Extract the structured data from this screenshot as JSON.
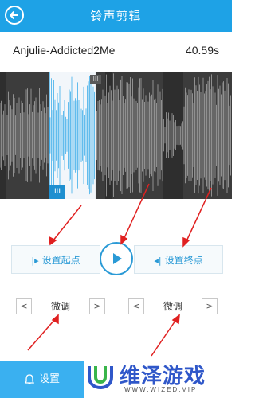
{
  "header": {
    "title": "铃声剪辑",
    "back_icon": "back-arrow-icon"
  },
  "track": {
    "name": "Anjulie-Addicted2Me",
    "duration": "40.59s"
  },
  "waveform": {
    "handle_top_label": "III",
    "handle_bottom_label": "III",
    "colors": {
      "background": "#3c3c3c",
      "wave": "#c8c8c8",
      "selected": "#2ba6e8"
    }
  },
  "controls": {
    "set_start": "设置起点",
    "set_end": "设置终点",
    "start_icon": "start-marker-icon",
    "end_icon": "end-marker-icon",
    "play_icon": "play-icon"
  },
  "fine_tune": {
    "left": {
      "label": "微调",
      "prev": "<",
      "next": ">"
    },
    "right": {
      "label": "微调",
      "prev": "<",
      "next": ">"
    }
  },
  "footer": {
    "settings_label": "设置",
    "settings_icon": "bell-icon"
  },
  "watermark": {
    "title": "维泽游戏",
    "url": "WWW.WIZED.VIP"
  },
  "colors": {
    "accent": "#1ea2e6",
    "annotation": "#e02020"
  }
}
